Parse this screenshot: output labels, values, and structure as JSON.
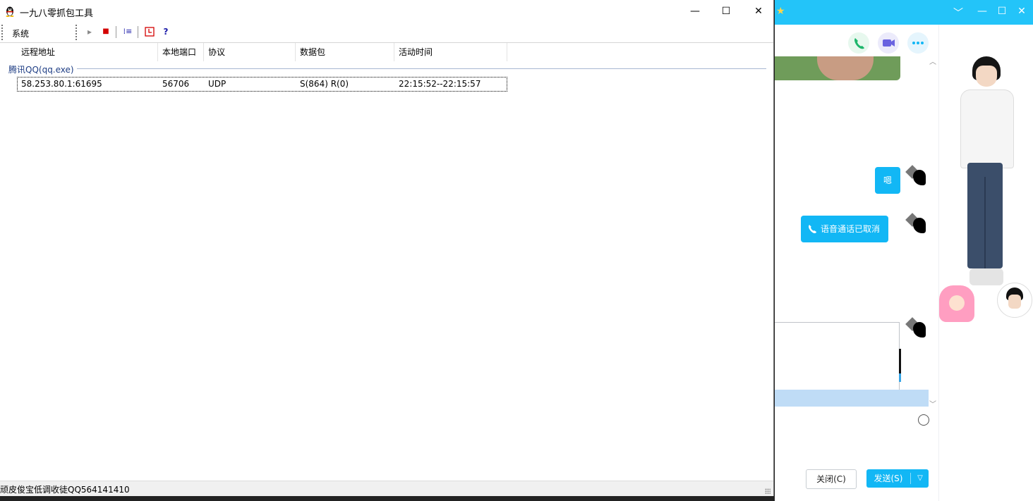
{
  "window": {
    "title": "一九八零抓包工具",
    "minimize_symbol": "—",
    "maximize_symbol": "☐",
    "close_symbol": "✕"
  },
  "toolbar": {
    "menu_system": "系统",
    "play_icon": "▸",
    "stop_icon": "■",
    "columns_icon": "⁞≡",
    "clock_icon": "⏱",
    "help_icon": "?",
    "stop_color": "#d40000",
    "help_color": "#1a1aa8"
  },
  "list": {
    "columns": [
      "远程地址",
      "本地端口",
      "协议",
      "数据包",
      "活动时间"
    ],
    "group": "腾讯QQ(qq.exe)",
    "rows": [
      {
        "remote": "58.253.80.1:61695",
        "local_port": "56706",
        "protocol": "UDP",
        "packets": "S(864) R(0)",
        "active_time": "22:15:52--22:15:57"
      }
    ]
  },
  "statusbar": {
    "text": "顽皮俊宝低调收徒QQ564141410"
  },
  "qq": {
    "accent": "#12b7f5",
    "messages": [
      "嗯",
      "语音通话已取消"
    ],
    "close_button": "关闭(C)",
    "send_button": "发送(S)",
    "window_controls": [
      "﹀",
      "—",
      "☐",
      "✕"
    ]
  }
}
